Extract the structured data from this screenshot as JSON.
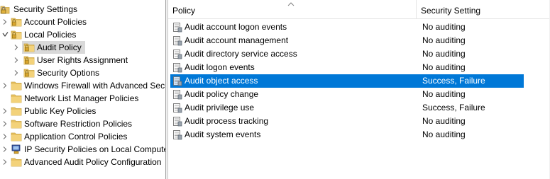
{
  "tree": {
    "items": [
      {
        "label": "Security Settings",
        "icon": "security-settings-icon",
        "toggle": "",
        "level": 0
      },
      {
        "label": "Account Policies",
        "icon": "folder-lock-icon",
        "toggle": "collapsed",
        "level": 1
      },
      {
        "label": "Local Policies",
        "icon": "folder-lock-icon",
        "toggle": "expanded",
        "level": 1
      },
      {
        "label": "Audit Policy",
        "icon": "folder-lock-icon",
        "toggle": "collapsed",
        "level": 2,
        "selected": true
      },
      {
        "label": "User Rights Assignment",
        "icon": "folder-lock-icon",
        "toggle": "collapsed",
        "level": 2
      },
      {
        "label": "Security Options",
        "icon": "folder-lock-icon",
        "toggle": "collapsed",
        "level": 2
      },
      {
        "label": "Windows Firewall with Advanced Secu",
        "icon": "folder-icon",
        "toggle": "collapsed",
        "level": 1
      },
      {
        "label": "Network List Manager Policies",
        "icon": "folder-icon",
        "toggle": "",
        "level": 1
      },
      {
        "label": "Public Key Policies",
        "icon": "folder-icon",
        "toggle": "collapsed",
        "level": 1
      },
      {
        "label": "Software Restriction Policies",
        "icon": "folder-icon",
        "toggle": "collapsed",
        "level": 1
      },
      {
        "label": "Application Control Policies",
        "icon": "folder-icon",
        "toggle": "collapsed",
        "level": 1
      },
      {
        "label": "IP Security Policies on Local Compute",
        "icon": "ip-security-icon",
        "toggle": "collapsed",
        "level": 1
      },
      {
        "label": "Advanced Audit Policy Configuration",
        "icon": "folder-icon",
        "toggle": "collapsed",
        "level": 1
      }
    ]
  },
  "list": {
    "columns": {
      "policy": "Policy",
      "setting": "Security Setting"
    },
    "rows": [
      {
        "policy": "Audit account logon events",
        "setting": "No auditing"
      },
      {
        "policy": "Audit account management",
        "setting": "No auditing"
      },
      {
        "policy": "Audit directory service access",
        "setting": "No auditing"
      },
      {
        "policy": "Audit logon events",
        "setting": "No auditing"
      },
      {
        "policy": "Audit object access",
        "setting": "Success, Failure",
        "selected": true
      },
      {
        "policy": "Audit policy change",
        "setting": "No auditing"
      },
      {
        "policy": "Audit privilege use",
        "setting": "Success, Failure"
      },
      {
        "policy": "Audit process tracking",
        "setting": "No auditing"
      },
      {
        "policy": "Audit system events",
        "setting": "No auditing"
      }
    ]
  },
  "colors": {
    "selection": "#0078d7",
    "tree_selection": "#d9d9d9",
    "folder": "#e8c263"
  }
}
